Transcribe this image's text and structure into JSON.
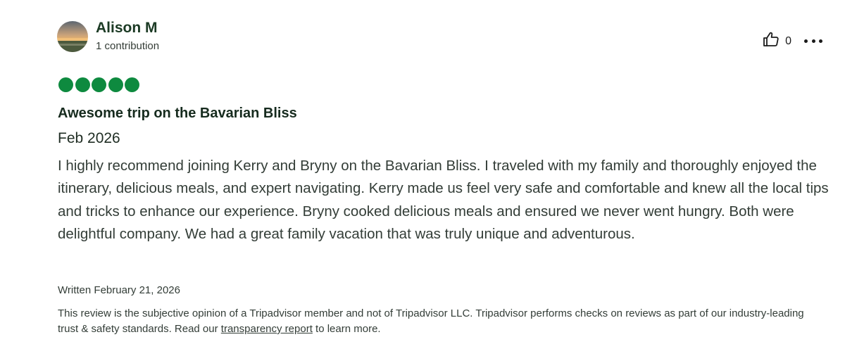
{
  "reviewer": {
    "name": "Alison M",
    "contributions": "1 contribution"
  },
  "actions": {
    "helpful_count": "0",
    "helpful_icon": "thumbs-up-icon",
    "more_icon": "more-dots-icon"
  },
  "rating": {
    "value": 5,
    "max": 5,
    "color": "#0e8a3f"
  },
  "review": {
    "title": "Awesome trip on the Bavarian Bliss",
    "date_of_travel": "Feb 2026",
    "body": "I highly recommend joining Kerry and Bryny on the Bavarian Bliss. I traveled with my family and thoroughly enjoyed the itinerary, delicious meals, and expert navigating. Kerry made us feel very safe and comfortable and knew all the local tips and tricks to enhance our experience. Bryny cooked delicious meals and ensured we never went hungry. Both were delightful company. We had a great family vacation that was truly unique and adventurous.",
    "written": "Written February 21, 2026"
  },
  "disclaimer": {
    "text_before": "This review is the subjective opinion of a Tripadvisor member and not of Tripadvisor LLC. Tripadvisor performs checks on reviews as part of our industry-leading trust & safety standards. Read our ",
    "link_label": "transparency report",
    "text_after": " to learn more."
  }
}
